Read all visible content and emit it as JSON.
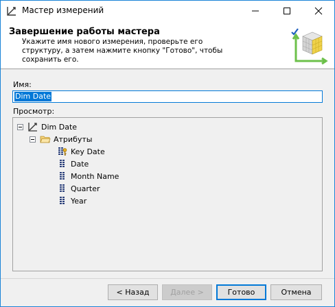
{
  "window": {
    "title": "Мастер измерений",
    "icon": "dimension-wizard-icon"
  },
  "header": {
    "title": "Завершение работы мастера",
    "description": "Укажите имя нового измерения, проверьте его структуру, а затем нажмите кнопку \"Готово\", чтобы сохранить его."
  },
  "form": {
    "name_label": "Имя:",
    "name_value": "Dim Date",
    "preview_label": "Просмотр:"
  },
  "tree": {
    "root": "Dim Date",
    "attributes_folder": "Атрибуты",
    "attributes": [
      "Key Date",
      "Date",
      "Month Name",
      "Quarter",
      "Year"
    ]
  },
  "buttons": {
    "back": "< Назад",
    "next": "Далее >",
    "finish": "Готово",
    "cancel": "Отмена"
  },
  "colors": {
    "accent": "#0078d7",
    "window_border": "#1883d7",
    "dialog_bg": "#f0f0f0"
  }
}
